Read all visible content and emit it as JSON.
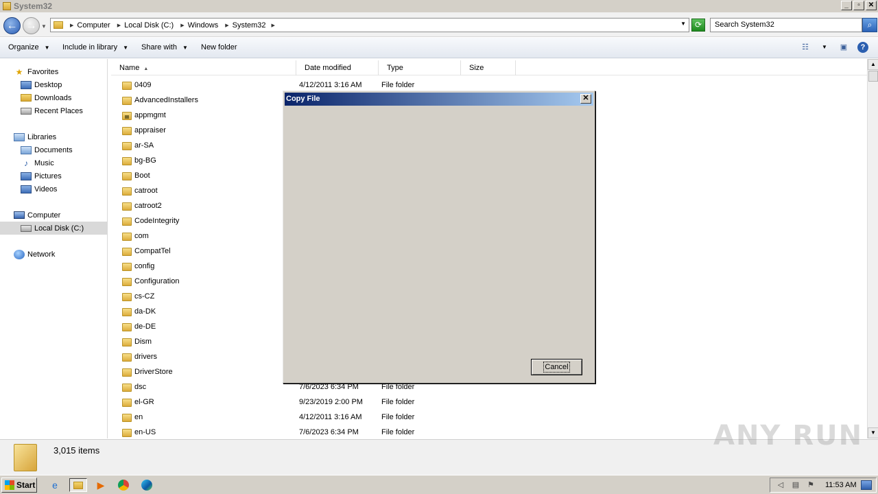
{
  "window": {
    "title": "System32"
  },
  "window_controls": {
    "minimize": "_",
    "maximize": "▫",
    "close": "✕"
  },
  "address": {
    "crumbs": [
      "Computer",
      "Local Disk (C:)",
      "Windows",
      "System32"
    ],
    "search_placeholder": "Search System32"
  },
  "commands": {
    "organize": "Organize",
    "include_in_library": "Include in library",
    "share_with": "Share with",
    "new_folder": "New folder"
  },
  "nav": {
    "favorites": "Favorites",
    "desktop": "Desktop",
    "downloads": "Downloads",
    "recent_places": "Recent Places",
    "libraries": "Libraries",
    "documents": "Documents",
    "music": "Music",
    "pictures": "Pictures",
    "videos": "Videos",
    "computer": "Computer",
    "local_disk": "Local Disk (C:)",
    "network": "Network"
  },
  "columns": {
    "name": "Name",
    "date_modified": "Date modified",
    "type": "Type",
    "size": "Size"
  },
  "files": [
    {
      "name": "0409",
      "date": "4/12/2011 3:16 AM",
      "type": "File folder"
    },
    {
      "name": "AdvancedInstallers",
      "date": "",
      "type": ""
    },
    {
      "name": "appmgmt",
      "date": "",
      "type": ""
    },
    {
      "name": "appraiser",
      "date": "",
      "type": ""
    },
    {
      "name": "ar-SA",
      "date": "",
      "type": ""
    },
    {
      "name": "bg-BG",
      "date": "",
      "type": ""
    },
    {
      "name": "Boot",
      "date": "",
      "type": ""
    },
    {
      "name": "catroot",
      "date": "",
      "type": ""
    },
    {
      "name": "catroot2",
      "date": "",
      "type": ""
    },
    {
      "name": "CodeIntegrity",
      "date": "",
      "type": ""
    },
    {
      "name": "com",
      "date": "",
      "type": ""
    },
    {
      "name": "CompatTel",
      "date": "",
      "type": ""
    },
    {
      "name": "config",
      "date": "",
      "type": ""
    },
    {
      "name": "Configuration",
      "date": "",
      "type": ""
    },
    {
      "name": "cs-CZ",
      "date": "",
      "type": ""
    },
    {
      "name": "da-DK",
      "date": "",
      "type": ""
    },
    {
      "name": "de-DE",
      "date": "",
      "type": ""
    },
    {
      "name": "Dism",
      "date": "",
      "type": ""
    },
    {
      "name": "drivers",
      "date": "",
      "type": ""
    },
    {
      "name": "DriverStore",
      "date": "",
      "type": ""
    },
    {
      "name": "dsc",
      "date": "7/6/2023 6:34 PM",
      "type": "File folder"
    },
    {
      "name": "el-GR",
      "date": "9/23/2019 2:00 PM",
      "type": "File folder"
    },
    {
      "name": "en",
      "date": "4/12/2011 3:16 AM",
      "type": "File folder"
    },
    {
      "name": "en-US",
      "date": "7/6/2023 6:34 PM",
      "type": "File folder"
    }
  ],
  "status": {
    "item_count": "3,015 items"
  },
  "dialog": {
    "title": "Copy File",
    "cancel_label": "Cancel",
    "close": "✕"
  },
  "taskbar": {
    "start_label": "Start",
    "clock": "11:53 AM"
  },
  "watermark": "ANY RUN",
  "icons": {
    "back": "back-arrow-icon",
    "forward": "forward-arrow-icon",
    "refresh": "refresh-icon",
    "search": "magnifier-icon",
    "folder": "folder-icon",
    "help": "help-icon"
  },
  "colors": {
    "dialog_title_start": "#0a246a",
    "dialog_title_end": "#a6caf0",
    "chrome_gray": "#d4d0c8"
  }
}
